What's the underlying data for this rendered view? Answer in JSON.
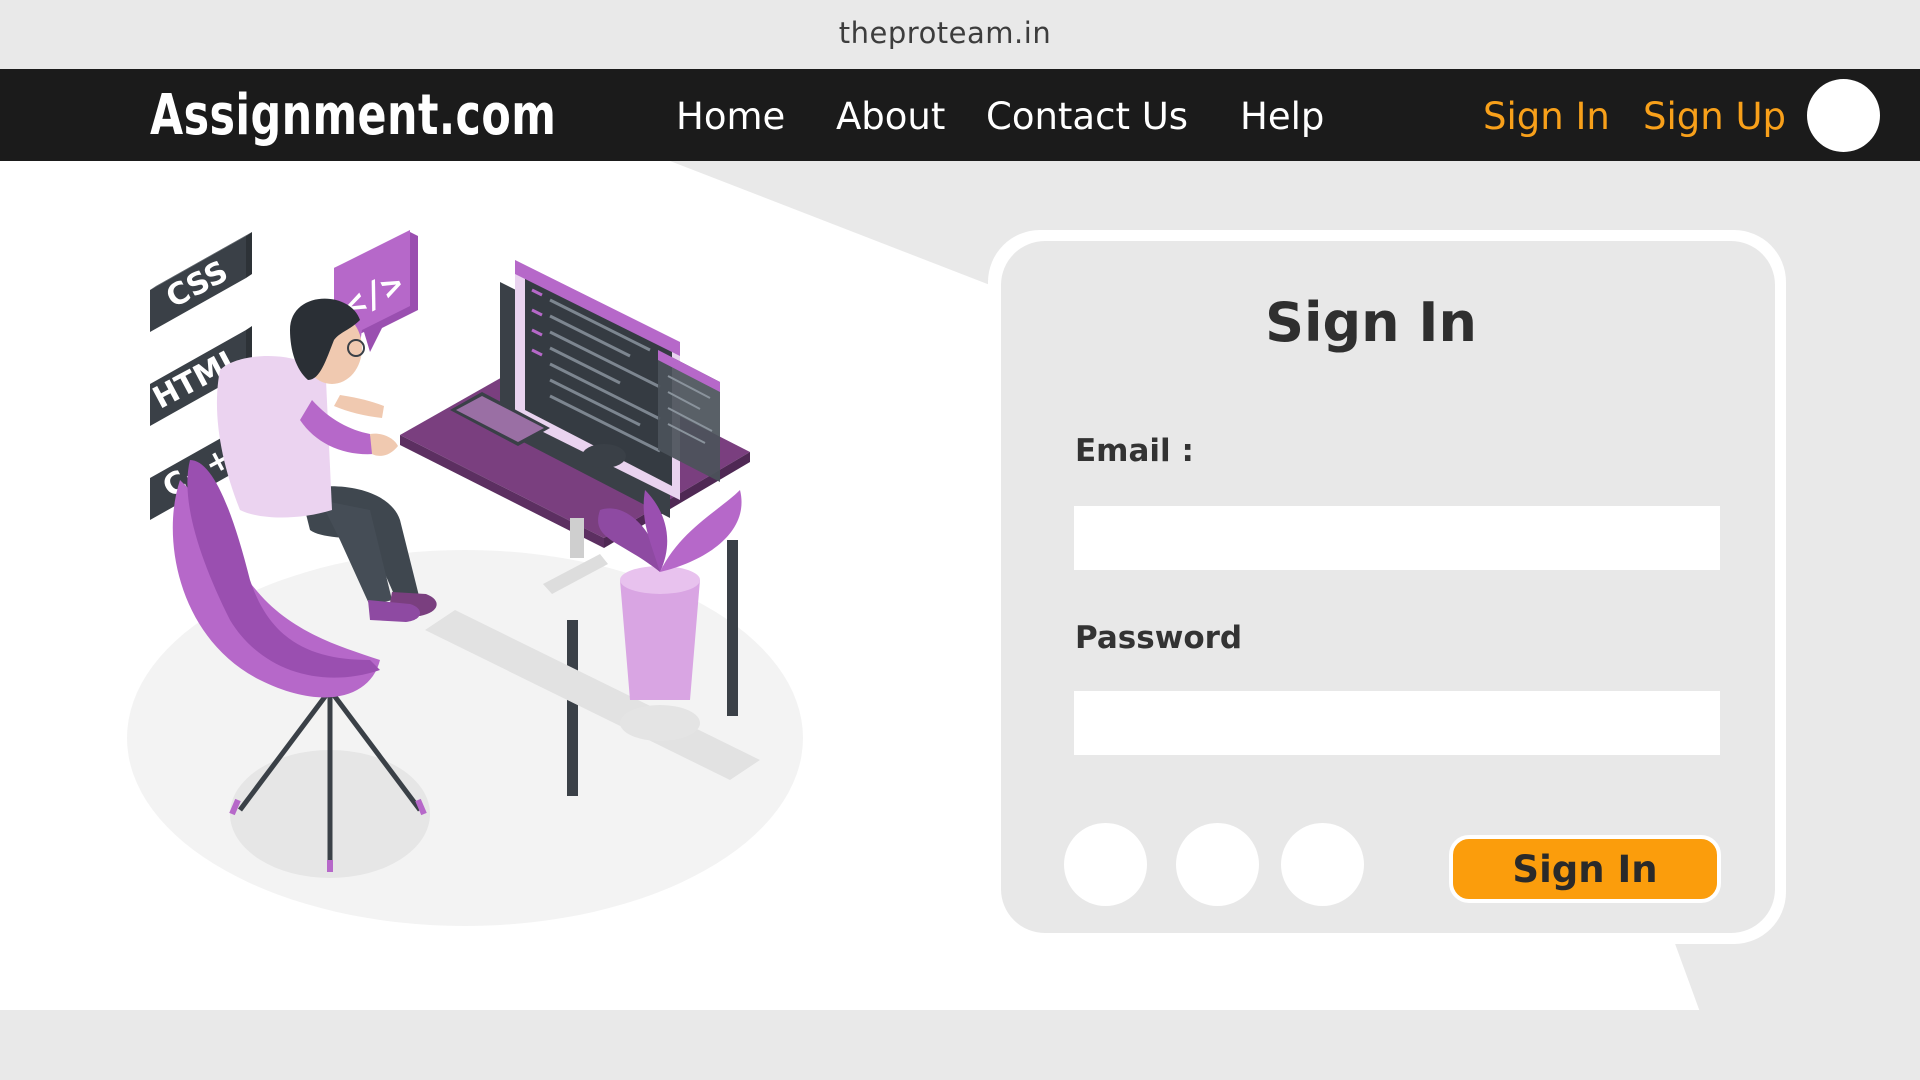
{
  "site": {
    "url": "theproteam.in"
  },
  "navbar": {
    "logo": "Assignment.com",
    "links": [
      {
        "label": "Home"
      },
      {
        "label": "About"
      },
      {
        "label": "Contact Us"
      },
      {
        "label": "Help"
      }
    ],
    "auth": {
      "sign_in": "Sign In",
      "sign_up": "Sign Up"
    },
    "profile_icon": "avatar-circle"
  },
  "illustration": {
    "tags": [
      "CSS",
      "HTML",
      "C++"
    ],
    "code_bubble": "</>"
  },
  "login_card": {
    "title": "Sign In",
    "email_label": "Email :",
    "email_value": "",
    "password_label": "Password",
    "password_value": "",
    "social_buttons": [
      "social-circle",
      "social-circle",
      "social-circle"
    ],
    "submit_label": "Sign In"
  },
  "colors": {
    "navbar_bg": "#1b1b1b",
    "accent": "#f8a01a",
    "button": "#fb9d0c",
    "illustration_purple": "#b668c9",
    "illustration_dark": "#3a4047",
    "page_bg": "#e9e9e9"
  }
}
